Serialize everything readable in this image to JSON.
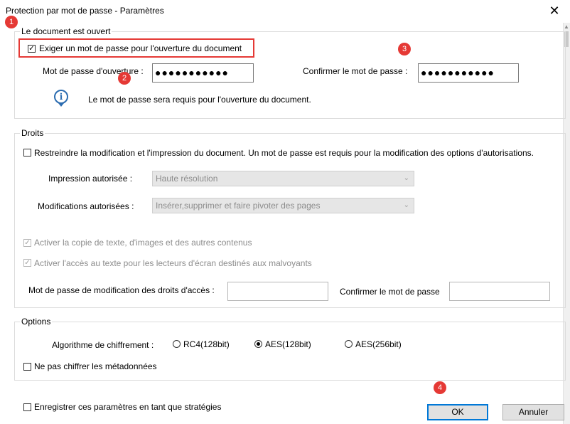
{
  "window": {
    "title": "Protection par mot de passe - Paramètres",
    "close_glyph": "✕"
  },
  "open_doc": {
    "legend": "Le document est ouvert",
    "require_label": "Exiger un mot de passe pour l'ouverture du document",
    "require_checked": true,
    "password_label": "Mot de passe d'ouverture :",
    "password_value": "●●●●●●●●●●●",
    "confirm_label": "Confirmer le mot de passe :",
    "confirm_value": "●●●●●●●●●●●",
    "info_text": "Le mot de passe sera requis pour l'ouverture du document."
  },
  "rights": {
    "legend": "Droits",
    "restrict_label": "Restreindre la modification et l'impression du document. Un mot de passe est requis pour la modification des options d'autorisations.",
    "restrict_checked": false,
    "print_label": "Impression autorisée :",
    "print_value": "Haute résolution",
    "changes_label": "Modifications autorisées :",
    "changes_value": "Insérer,supprimer et faire pivoter des pages",
    "copy_label": "Activer la copie de texte, d'images et des autres contenus",
    "copy_checked": true,
    "access_label": "Activer l'accès au texte pour les lecteurs d'écran destinés aux malvoyants",
    "access_checked": true,
    "perm_password_label": "Mot de passe de modification des droits d'accès :",
    "perm_password_value": "",
    "perm_confirm_label": "Confirmer le mot de passe",
    "perm_confirm_value": ""
  },
  "options": {
    "legend": "Options",
    "algo_label": "Algorithme de chiffrement :",
    "algorithms": [
      {
        "label": "RC4(128bit)",
        "selected": false
      },
      {
        "label": "AES(128bit)",
        "selected": true
      },
      {
        "label": "AES(256bit)",
        "selected": false
      }
    ],
    "no_metadata_label": "Ne pas chiffrer les métadonnées",
    "no_metadata_checked": false
  },
  "footer": {
    "save_policy_label": "Enregistrer ces paramètres en tant que stratégies",
    "save_policy_checked": false,
    "ok_label": "OK",
    "cancel_label": "Annuler"
  },
  "markers": [
    "1",
    "2",
    "3",
    "4"
  ],
  "icons": {
    "check": "✓",
    "dropdown": "⌄",
    "info": "i",
    "scroll_up": "▲"
  },
  "colors": {
    "accent": "#0078d7",
    "marker_red": "#e53935",
    "info_blue": "#2b6cb0"
  }
}
